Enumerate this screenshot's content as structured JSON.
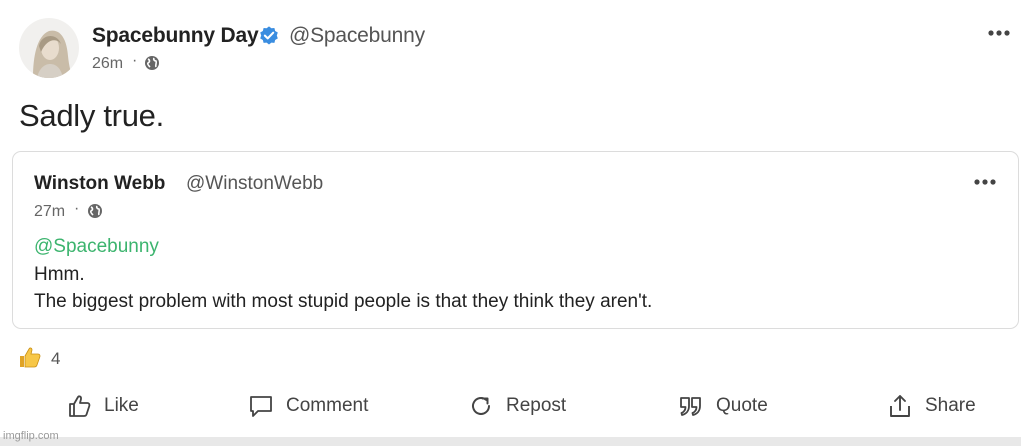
{
  "post": {
    "author_name": "Spacebunny Day",
    "author_handle": "@Spacebunny",
    "time": "26m",
    "separator": "·",
    "text": "Sadly true."
  },
  "quoted_post": {
    "author_name": "Winston Webb",
    "author_handle": "@WinstonWebb",
    "time": "27m",
    "separator": "·",
    "mention": "@Spacebunny",
    "line1": "Hmm.",
    "line2": "The biggest problem with most stupid people is that they think they aren't."
  },
  "reactions": {
    "count": "4",
    "icon": "thumbs-up-icon"
  },
  "actions": {
    "like": "Like",
    "comment": "Comment",
    "repost": "Repost",
    "quote": "Quote",
    "share": "Share"
  },
  "watermark": "imgflip.com",
  "colors": {
    "verified": "#3a8de0",
    "mention": "#3cb46e",
    "text": "#222222",
    "muted": "#666666"
  }
}
